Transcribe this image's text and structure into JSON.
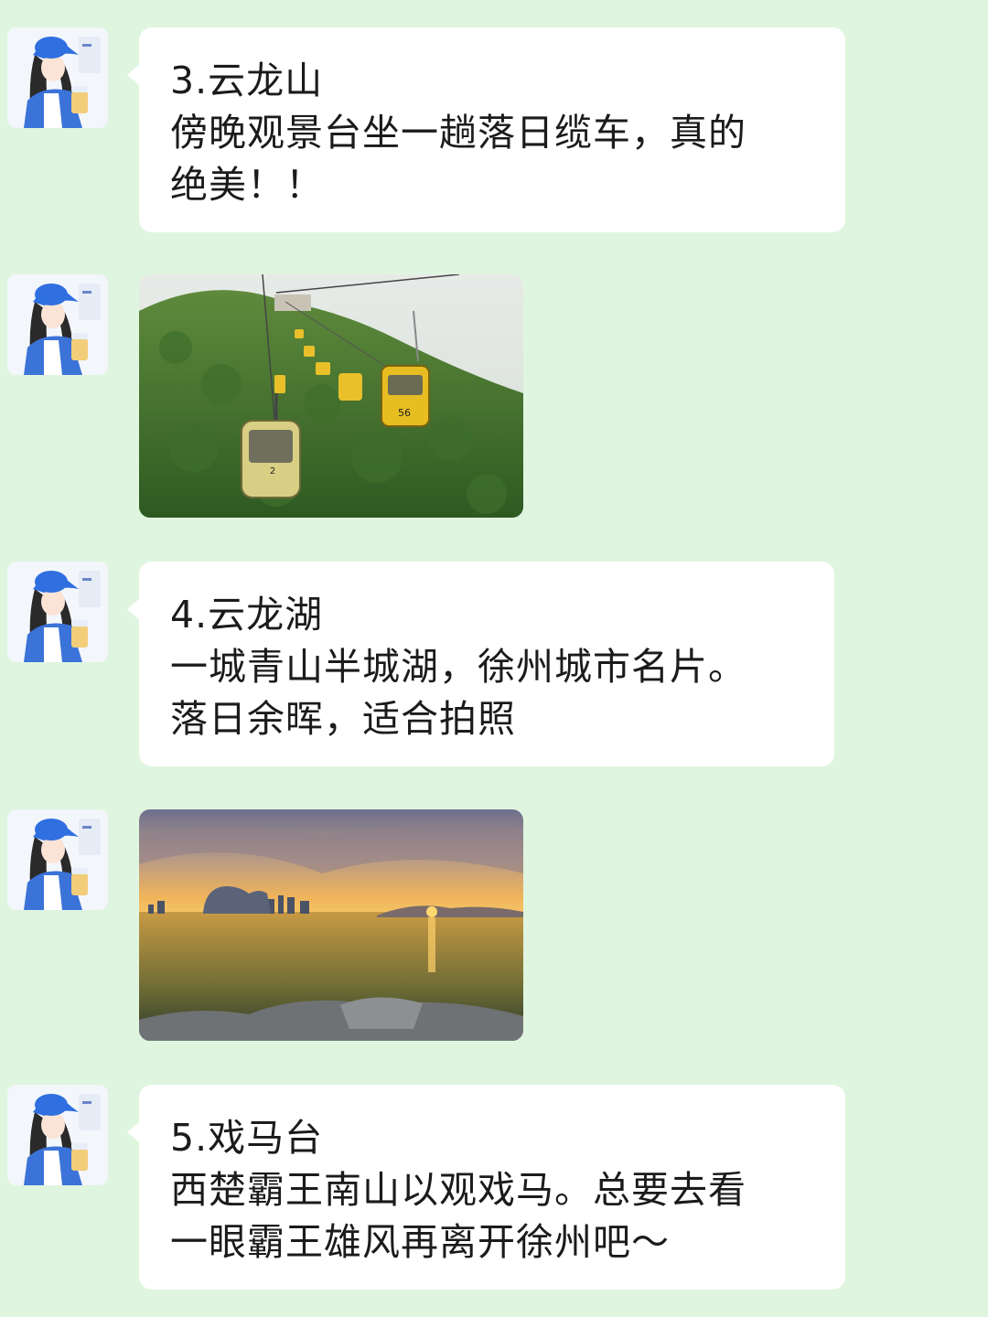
{
  "messages": [
    {
      "type": "text",
      "lines": [
        "3.云龙山",
        "傍晚观景台坐一趟落日缆车，真的",
        "绝美！！"
      ]
    },
    {
      "type": "image",
      "subject": "cable-car-photo"
    },
    {
      "type": "text",
      "lines": [
        "4.云龙湖",
        "一城青山半城湖，徐州城市名片。",
        "落日余晖，适合拍照"
      ]
    },
    {
      "type": "image",
      "subject": "lake-sunset-photo"
    },
    {
      "type": "text",
      "lines": [
        "5.戏马台",
        "西楚霸王南山以观戏马。总要去看",
        "一眼霸王雄风再离开徐州吧～"
      ]
    }
  ],
  "photo_text": {
    "cabin_number_large": "56",
    "cabin_number_small": "2"
  },
  "colors": {
    "background": "#dff5df",
    "bubble": "#ffffff",
    "avatar_cap": "#2f6fe0"
  }
}
